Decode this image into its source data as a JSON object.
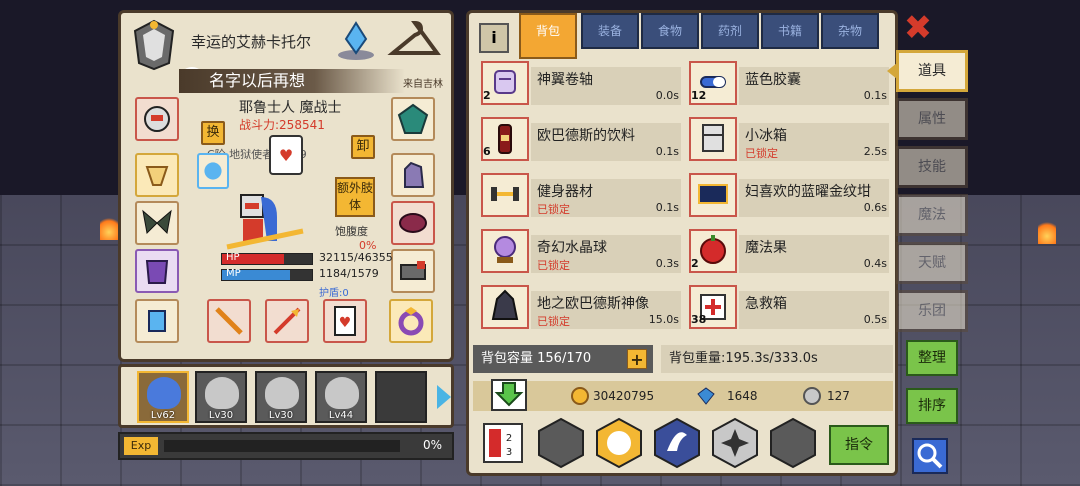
{
  "hero": {
    "title": "幸运的艾赫卡托尔",
    "name_bar": "名字以后再想",
    "origin": "来自吉林",
    "class_name": "耶鲁士人 魔战士",
    "power": "战斗力:258541",
    "rank_line": "C阶 地狱使者  Lv 29",
    "swap_label": "换",
    "unequip_label": "卸",
    "extra_limb_label": "额外肢体",
    "satiety_label": "饱腹度",
    "satiety_value": "0%",
    "hp_label": "HP",
    "hp_value": "32115/46355",
    "mp_label": "MP",
    "mp_value": "1184/1579",
    "shield_label": "护盾:0",
    "hp_fraction": 0.69,
    "mp_fraction": 0.75
  },
  "party": [
    {
      "level": "Lv62",
      "selected": true
    },
    {
      "level": "Lv30",
      "selected": false
    },
    {
      "level": "Lv30",
      "selected": false
    },
    {
      "level": "Lv44",
      "selected": false
    },
    {
      "level": "",
      "selected": false
    }
  ],
  "exp": {
    "label": "Exp",
    "value": "0%",
    "fraction": 0.0
  },
  "tabs": [
    {
      "label": "背包",
      "active": true
    },
    {
      "label": "装备",
      "active": false
    },
    {
      "label": "食物",
      "active": false
    },
    {
      "label": "药剂",
      "active": false
    },
    {
      "label": "书籍",
      "active": false
    },
    {
      "label": "杂物",
      "active": false
    }
  ],
  "items": [
    {
      "name": "神翼卷轴",
      "count": "2",
      "time": "0.0s",
      "locked": "",
      "icon": "scroll-icon"
    },
    {
      "name": "蓝色胶囊",
      "count": "12",
      "time": "0.1s",
      "locked": "",
      "icon": "capsule-icon"
    },
    {
      "name": "欧巴德斯的饮料",
      "count": "6",
      "time": "0.1s",
      "locked": "",
      "icon": "drink-bottle-icon"
    },
    {
      "name": "小冰箱",
      "count": "",
      "time": "2.5s",
      "locked": "已锁定",
      "icon": "fridge-icon"
    },
    {
      "name": "健身器材",
      "count": "",
      "time": "0.1s",
      "locked": "已锁定",
      "icon": "dumbbell-icon"
    },
    {
      "name": "妇喜欢的蓝曜金纹坩",
      "count": "",
      "time": "0.6s",
      "locked": "",
      "icon": "blue-box-icon"
    },
    {
      "name": "奇幻水晶球",
      "count": "",
      "time": "0.3s",
      "locked": "已锁定",
      "icon": "crystal-ball-icon"
    },
    {
      "name": "魔法果",
      "count": "2",
      "time": "0.4s",
      "locked": "",
      "icon": "magic-fruit-icon"
    },
    {
      "name": "地之欧巴德斯神像",
      "count": "",
      "time": "15.0s",
      "locked": "已锁定",
      "icon": "statue-icon"
    },
    {
      "name": "急救箱",
      "count": "38",
      "time": "0.5s",
      "locked": "",
      "icon": "first-aid-icon"
    }
  ],
  "capacity": "背包容量 156/170",
  "capacity_plus": "+",
  "weight": "背包重量:195.3s/333.0s",
  "currency": {
    "gold": "30420795",
    "diamond": "1648",
    "silver": "127"
  },
  "command_label": "指令",
  "side_tabs": [
    {
      "label": "道具",
      "active": true
    },
    {
      "label": "属性",
      "active": false
    },
    {
      "label": "技能",
      "active": false
    },
    {
      "label": "魔法",
      "active": false
    },
    {
      "label": "天赋",
      "active": false
    },
    {
      "label": "乐团",
      "active": false
    }
  ],
  "organize_label": "整理",
  "sort_label": "排序",
  "close_symbol": "✖"
}
